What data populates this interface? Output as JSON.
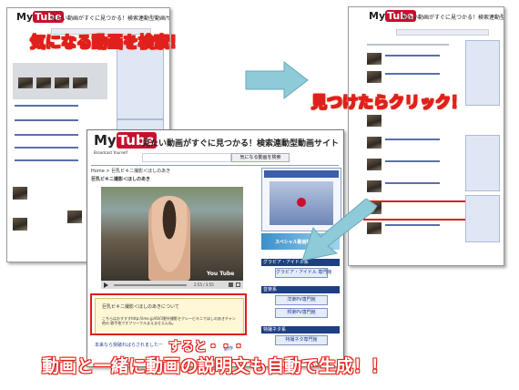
{
  "site": {
    "logo_my": "My",
    "logo_tube": "Tube",
    "logo_tag": "Broadcast Yourself",
    "title": "見たい動画がすぐに見つかる！検索連動型動画サイト",
    "search_button": "気になる動画を検索"
  },
  "callouts": {
    "search": "気になる動画を検索！",
    "click": "見つけたらクリック！",
    "then": "すると・・・",
    "result": "動画と一緒に動画の説明文も自動で生成！！"
  },
  "player": {
    "breadcrumb": "Home > 巨乳ビキニ撮影＜ほしのあき",
    "video_title": "巨乳ビキニ撮影＜ほしのあき",
    "time": "2:55 / 3:55",
    "watermark": "You Tube"
  },
  "description": {
    "title": "巨乳ビキニ撮影＜ほしのあきについて",
    "body": "こちらはおすすすhttp://ime.jp/00/3野外撮影セクシービキニでほしのあきチャン他の 歌手他ですフリーフルまえませえんね。"
  },
  "sidebar": {
    "banner": "スペシャル動画特集",
    "heading1": "グラビア・アイドル系",
    "btn1": "グラビア・アイドル 専門館",
    "heading2": "音楽系",
    "btn2": "洋楽PV専門館",
    "btn3": "邦楽PV専門館",
    "heading3": "特撮ネタ系",
    "btn4": "特撮ネタ専門館"
  },
  "footer": {
    "note": "本来なら突破ればらされましたー",
    "link": "副作"
  },
  "colors": {
    "callout_red": "#e0201c",
    "callout_fill": "#f08a3c",
    "arrow": "#8ecad8",
    "brand_red": "#c8102e",
    "nav_blue": "#1f3f85"
  }
}
